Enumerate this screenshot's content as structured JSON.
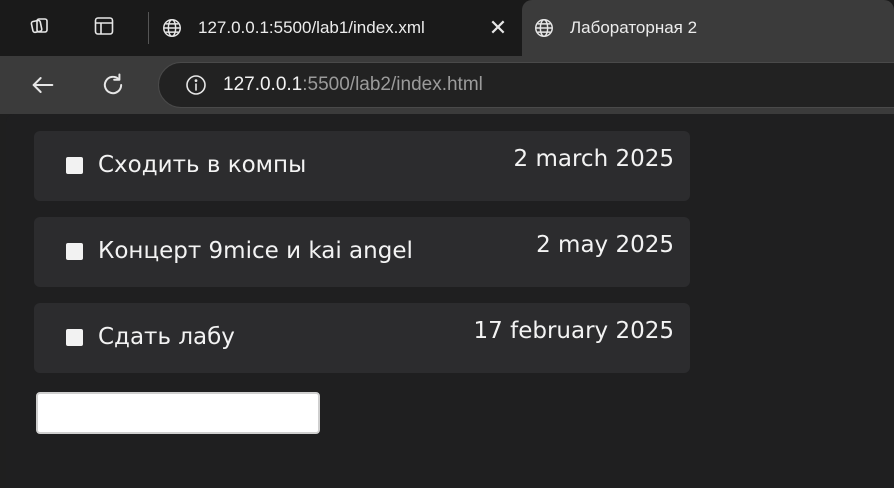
{
  "browser": {
    "tabs": [
      {
        "title": "127.0.0.1:5500/lab1/index.xml",
        "icon": "globe-icon",
        "active": false
      },
      {
        "title": "Лабораторная 2",
        "icon": "globe-icon",
        "active": true
      }
    ],
    "close_glyph": "✕",
    "address": {
      "host": "127.0.0.1",
      "rest": ":5500/lab2/index.html"
    }
  },
  "tasks": [
    {
      "label": "Сходить в компы",
      "date": "2 march 2025",
      "checked": false
    },
    {
      "label": "Концерт 9mice и kai angel",
      "date": "2 may 2025",
      "checked": false
    },
    {
      "label": "Сдать лабу",
      "date": "17 february 2025",
      "checked": false
    }
  ],
  "new_task": {
    "value": "",
    "placeholder": ""
  },
  "colors": {
    "page_bg": "#1f1f20",
    "card_bg": "#2c2c2e",
    "tab_active_bg": "#3b3b3b",
    "tabstrip_bg": "#1a1a1a"
  }
}
